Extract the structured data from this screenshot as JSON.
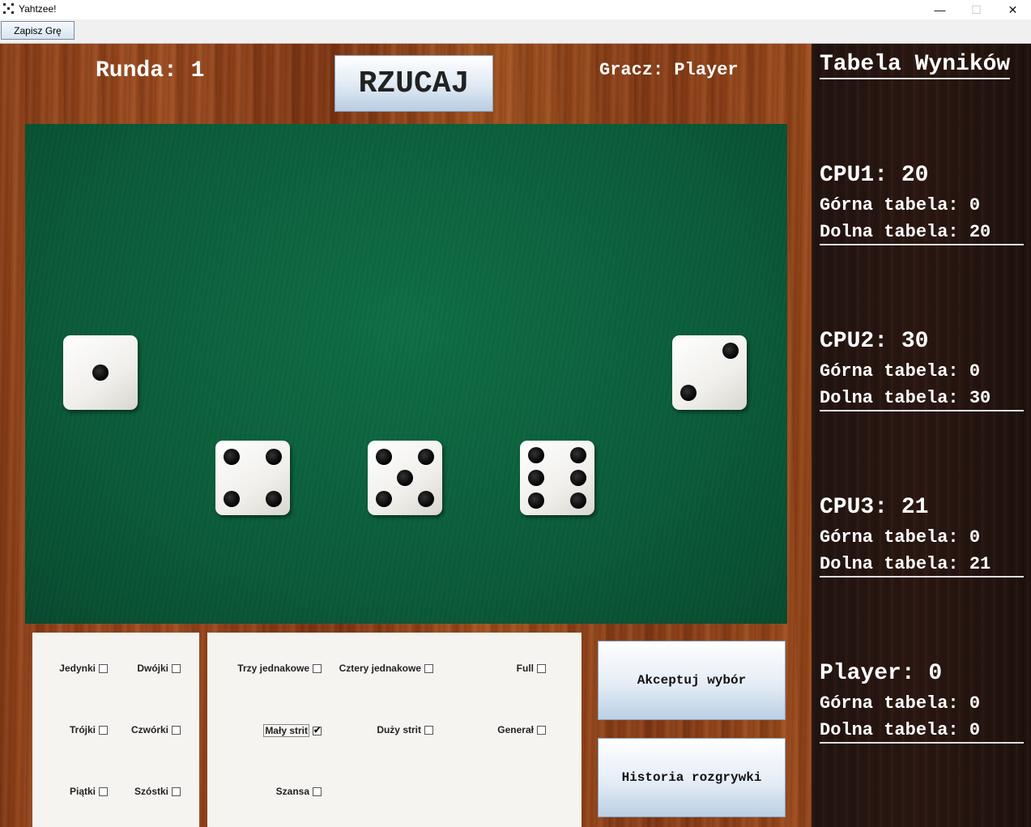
{
  "window": {
    "title": "Yahtzee!",
    "controls": {
      "minimize": "—",
      "maximize": "☐",
      "close": "✕"
    }
  },
  "menu": {
    "save_label": "Zapisz Grę"
  },
  "game": {
    "round_label": "Runda: 1",
    "roll_label": "RZUCAJ",
    "player_label": "Gracz: Player"
  },
  "dice": [
    1,
    4,
    5,
    6,
    2
  ],
  "upper_categories": [
    {
      "label": "Jedynki",
      "checked": false
    },
    {
      "label": "Dwójki",
      "checked": false
    },
    {
      "label": "Trójki",
      "checked": false
    },
    {
      "label": "Czwórki",
      "checked": false
    },
    {
      "label": "Piątki",
      "checked": false
    },
    {
      "label": "Szóstki",
      "checked": false
    }
  ],
  "lower_categories": [
    {
      "label": "Trzy jednakowe",
      "checked": false
    },
    {
      "label": "Cztery jednakowe",
      "checked": false
    },
    {
      "label": "Full",
      "checked": false
    },
    {
      "label": "Mały strit",
      "checked": true
    },
    {
      "label": "Duży strit",
      "checked": false
    },
    {
      "label": "Generał",
      "checked": false
    },
    {
      "label": "Szansa",
      "checked": false
    }
  ],
  "actions": {
    "accept_label": "Akceptuj wybór",
    "history_label": "Historia rozgrywki"
  },
  "score_table": {
    "title": "Tabela Wyników",
    "players": [
      {
        "heading": "CPU1: 20",
        "upper": "Górna tabela: 0",
        "lower": "Dolna tabela: 20"
      },
      {
        "heading": "CPU2: 30",
        "upper": "Górna tabela: 0",
        "lower": "Dolna tabela: 30"
      },
      {
        "heading": "CPU3: 21",
        "upper": "Górna tabela: 0",
        "lower": "Dolna tabela: 21"
      },
      {
        "heading": "Player: 0",
        "upper": "Górna tabela: 0",
        "lower": "Dolna tabela: 0"
      }
    ]
  }
}
